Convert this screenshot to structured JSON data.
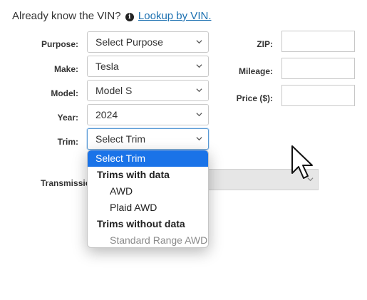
{
  "vin": {
    "question": "Already know the VIN?",
    "icon": "info-circle-icon",
    "link": "Lookup by VIN."
  },
  "form": {
    "purpose": {
      "label": "Purpose:",
      "value": "Select Purpose"
    },
    "make": {
      "label": "Make:",
      "value": "Tesla"
    },
    "model": {
      "label": "Model:",
      "value": "Model S"
    },
    "year": {
      "label": "Year:",
      "value": "2024"
    },
    "trim": {
      "label": "Trim:",
      "value": "Select Trim"
    },
    "transmission": {
      "label": "Transmissio"
    },
    "zip": {
      "label": "ZIP:",
      "value": ""
    },
    "mileage": {
      "label": "Mileage:",
      "value": ""
    },
    "price": {
      "label": "Price ($):",
      "value": ""
    }
  },
  "trim_dropdown": {
    "selected": "Select Trim",
    "groups": [
      {
        "label": "Trims with data",
        "options": [
          "AWD",
          "Plaid AWD"
        ],
        "disabled": false
      },
      {
        "label": "Trims without data",
        "options": [
          "Standard Range AWD"
        ],
        "disabled": true
      }
    ]
  },
  "colors": {
    "link": "#1a6fb0",
    "highlight": "#1a73e8",
    "focus_border": "#5b9bd5",
    "disabled_text": "#8a8a8a"
  }
}
